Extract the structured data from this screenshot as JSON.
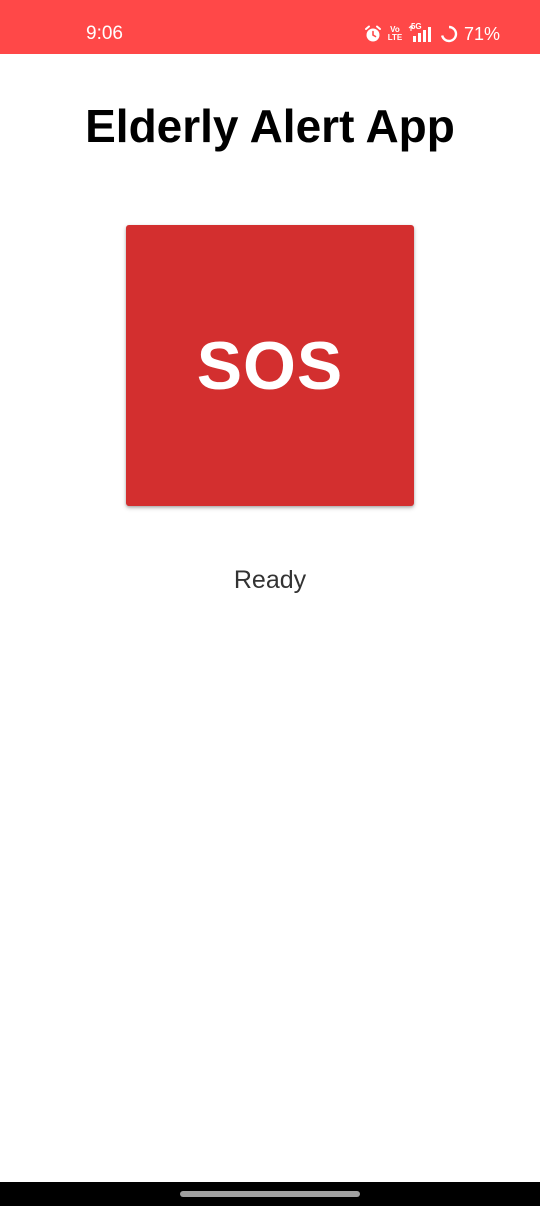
{
  "colors": {
    "status_bar_bg": "#ff4848",
    "sos_bg": "#d32f2f",
    "sos_text": "#ffffff",
    "title_text": "#000000",
    "status_text": "#333333"
  },
  "status_bar": {
    "time": "9:06",
    "volte_top": "Vo",
    "volte_bottom": "LTE",
    "network": "5G",
    "battery_percent": "71%",
    "icons": [
      "alarm-icon",
      "volte-icon",
      "signal-icon",
      "battery-ring-icon"
    ]
  },
  "app": {
    "title": "Elderly Alert App",
    "sos_label": "SOS",
    "status": "Ready"
  }
}
